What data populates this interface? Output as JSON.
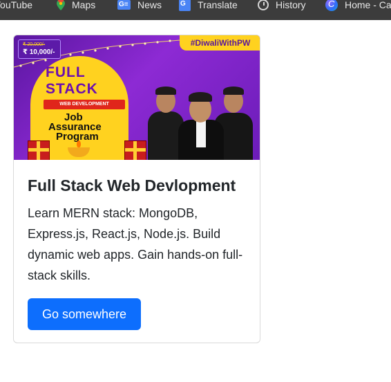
{
  "bookmarks": [
    {
      "label": "YouTube",
      "icon": "youtube-icon"
    },
    {
      "label": "Maps",
      "icon": "maps-icon"
    },
    {
      "label": "News",
      "icon": "news-icon"
    },
    {
      "label": "Translate",
      "icon": "translate-icon"
    },
    {
      "label": "History",
      "icon": "history-icon"
    },
    {
      "label": "Home - Ca",
      "icon": "canva-icon"
    }
  ],
  "card": {
    "image": {
      "hashtag": "#DiwaliWithPW",
      "old_price": "₹ 20,000/-",
      "new_price": "₹ 10,000/-",
      "line1": "FULL",
      "line2": "STACK",
      "ribbon": "WEB DEVELOPMENT",
      "line3": "Job",
      "line4": "Assurance",
      "line5": "Program"
    },
    "title": "Full Stack Web Devlopment",
    "text": "Learn MERN stack: MongoDB, Express.js, React.js, Node.js. Build dynamic web apps. Gain hands-on full-stack skills.",
    "button_label": "Go somewhere"
  },
  "colors": {
    "bookmarks_bg": "#3c3c3c",
    "primary_button": "#0d6efd",
    "banner_purple": "#7a22c8",
    "banner_yellow": "#ffd21f"
  }
}
